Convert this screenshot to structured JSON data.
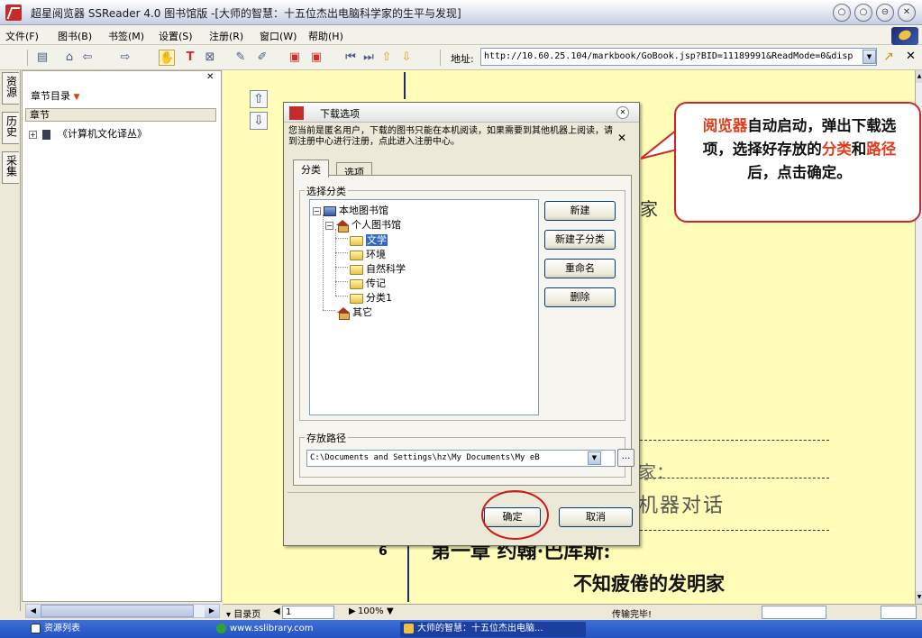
{
  "window": {
    "title": "超星阅览器 SSReader 4.0 图书馆版 -[大师的智慧：十五位杰出电脑科学家的生平与发现]",
    "minimize_glyph": "○",
    "restore_glyph": "○",
    "maximize_glyph": "⊖",
    "close_glyph": "✕"
  },
  "menu": [
    "文件(F)",
    "图书(B)",
    "书签(M)",
    "设置(S)",
    "注册(R)",
    "窗口(W)",
    "帮助(H)"
  ],
  "address": {
    "label": "地址:",
    "value": "http://10.60.25.104/markbook/GoBook.jsp?BID=11189991&ReadMode=0&disp"
  },
  "sidetabs": [
    "资源",
    "历史",
    "采集"
  ],
  "left_panel": {
    "chapter_dir": "章节目录",
    "chapter_header": "章节",
    "tree_root": "《计算机文化译丛》"
  },
  "book": {
    "text1": "家：",
    "text2": "机器对话",
    "page_no": "6",
    "chapter": "第一章 约翰·巴库斯:",
    "subtitle": "不知疲倦的发明家",
    "frag": "家"
  },
  "dialog": {
    "title": "下载选项",
    "notice": "您当前是匿名用户，下载的图书只能在本机阅读，如果需要到其他机器上阅读，请到注册中心进行注册，点此进入注册中心。",
    "tabs": [
      "分类",
      "选项"
    ],
    "group_category": "选择分类",
    "tree": {
      "root": "本地图书馆",
      "personal": "个人图书馆",
      "children": [
        "文学",
        "环境",
        "自然科学",
        "传记",
        "分类1"
      ],
      "other": "其它"
    },
    "buttons": {
      "new": "新建",
      "new_sub": "新建子分类",
      "rename": "重命名",
      "delete": "删除",
      "ok": "确定",
      "cancel": "取消"
    },
    "group_path": "存放路径",
    "path_value": "C:\\Documents and Settings\\hz\\My Documents\\My eB",
    "browse_label": "..."
  },
  "callout": {
    "parts": [
      {
        "text": "阅览器",
        "hl": true
      },
      {
        "text": "自动启动，弹出下载选项，选择好存放的",
        "hl": false
      },
      {
        "text": "分类",
        "hl": true
      },
      {
        "text": "和",
        "hl": false
      },
      {
        "text": "路径",
        "hl": true
      },
      {
        "text": "后，点击确定。",
        "hl": false
      }
    ],
    "highlight_color": "#e23c1c",
    "border_color": "#d22525"
  },
  "status": {
    "toc_page": "目录页",
    "page_value": "1",
    "zoom": "100%",
    "transfer": "传输完毕!"
  },
  "taskbar": {
    "items": [
      "资源列表",
      "www.sslibrary.com",
      "大师的智慧：十五位杰出电脑..."
    ]
  }
}
